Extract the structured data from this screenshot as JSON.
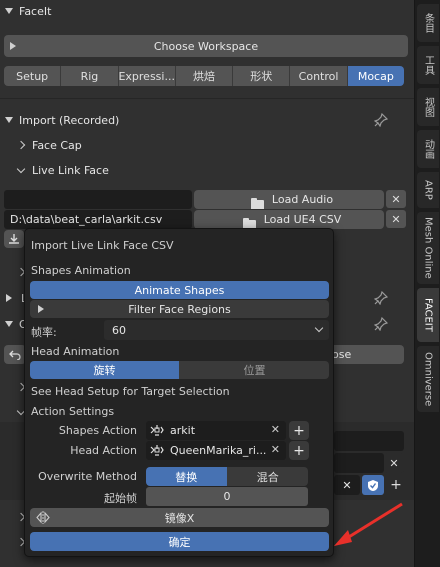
{
  "panel": {
    "title": "FaceIt",
    "choose_workspace": "Choose Workspace",
    "workspace_tabs": [
      "Setup",
      "Rig",
      "Expressi...",
      "烘焙",
      "形状",
      "Control",
      "Mocap"
    ],
    "active_tab": "Mocap",
    "import_section": "Import (Recorded)",
    "face_cap": "Face Cap",
    "live_link_face": "Live Link Face",
    "audio_path": "",
    "load_audio": "Load Audio",
    "csv_path": "D:\\data\\beat_carla\\arkit.csv",
    "load_csv": "Load UE4 CSV",
    "collapsed_label_l": "L",
    "collapsed_label_o": "O",
    "bg_button_partial": "ose",
    "bg_field_1": "",
    "bg_field_2": ""
  },
  "side_tabs": [
    "条目",
    "工具",
    "视图",
    "动画",
    "ARP",
    "Mesh Online",
    "FACEIT",
    "Omniverse"
  ],
  "active_side_tab": "FACEIT",
  "popup": {
    "title": "Import Live Link Face CSV",
    "shapes_animation": "Shapes Animation",
    "animate_shapes": "Animate Shapes",
    "filter_face_regions": "Filter Face Regions",
    "fps_label": "帧率:",
    "fps_value": "60",
    "head_animation": "Head Animation",
    "head_rotation": "旋转",
    "head_location": "位置",
    "head_setup_note": "See Head Setup for Target Selection",
    "action_settings": "Action Settings",
    "shapes_action_label": "Shapes Action",
    "shapes_action_value": "arkit",
    "head_action_label": "Head Action",
    "head_action_value": "QueenMarika_ri...",
    "overwrite_label": "Overwrite Method",
    "overwrite_replace": "替换",
    "overwrite_mix": "混合",
    "start_frame_label": "起始帧",
    "start_frame_value": "0",
    "mirror_x": "镜像X",
    "confirm": "确定"
  },
  "colors": {
    "accent": "#4772b3",
    "annotation_arrow": "#e8302a"
  }
}
